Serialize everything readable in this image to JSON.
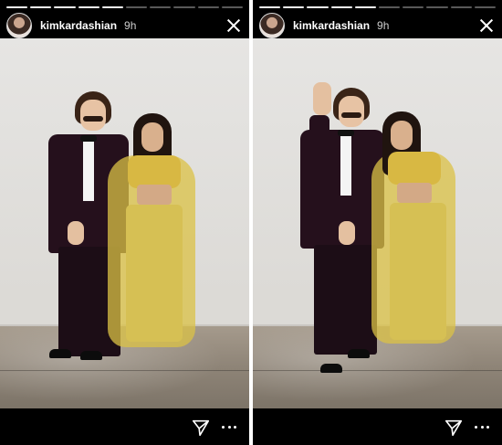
{
  "stories": [
    {
      "username": "kimkardashian",
      "time": "9h",
      "progress_done": 5,
      "progress_total": 10
    },
    {
      "username": "kimkardashian",
      "time": "9h",
      "progress_done": 5,
      "progress_total": 10
    }
  ],
  "icons": {
    "close": "close-icon",
    "share": "send-icon",
    "more": "more-icon",
    "avatar": "avatar"
  },
  "colors": {
    "background": "#000000",
    "text": "#ffffff"
  }
}
